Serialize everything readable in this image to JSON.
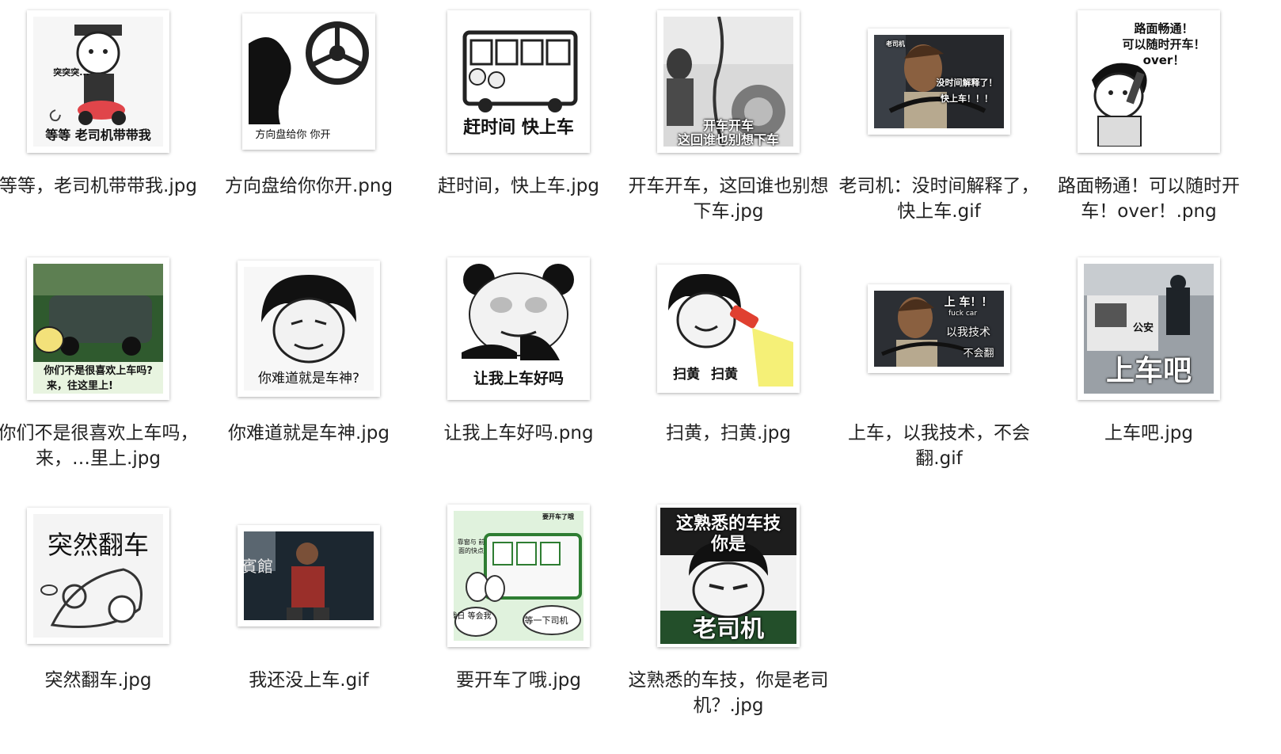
{
  "files": [
    {
      "name": "等等，老司机带带我.jpg",
      "icon": "meme-thumbnail-icon",
      "captions": [
        "突突突...",
        "等等 老司机带带我"
      ]
    },
    {
      "name": "方向盘给你你开.png",
      "icon": "meme-thumbnail-icon",
      "captions": [
        "方向盘给你 你开"
      ]
    },
    {
      "name": "赶时间，快上车.jpg",
      "icon": "meme-thumbnail-icon",
      "captions": [
        "赶时间 快上车"
      ]
    },
    {
      "name": "开车开车，这回谁也别想下车.jpg",
      "icon": "meme-thumbnail-icon",
      "captions": [
        "开车开车",
        "这回谁也别想下车"
      ]
    },
    {
      "name": "老司机：没时间解释了，快上车.gif",
      "icon": "meme-thumbnail-icon",
      "captions": [
        "老司机",
        "没时间解释了！",
        "快上车！！！"
      ]
    },
    {
      "name": "路面畅通！可以随时开车！over！.png",
      "icon": "meme-thumbnail-icon",
      "captions": [
        "路面畅通！",
        "可以随时开车！",
        "over！"
      ]
    },
    {
      "name": "你们不是很喜欢上车吗，来，…里上.jpg",
      "icon": "meme-thumbnail-icon",
      "captions": [
        "你们不是很喜欢上车吗?",
        "来，往这里上!"
      ]
    },
    {
      "name": "你难道就是车神.jpg",
      "icon": "meme-thumbnail-icon",
      "captions": [
        "你难道就是车神?"
      ]
    },
    {
      "name": "让我上车好吗.png",
      "icon": "meme-thumbnail-icon",
      "captions": [
        "让我上车好吗"
      ]
    },
    {
      "name": "扫黄，扫黄.jpg",
      "icon": "meme-thumbnail-icon",
      "captions": [
        "扫黄",
        "扫黄"
      ]
    },
    {
      "name": "上车，以我技术，不会翻.gif",
      "icon": "meme-thumbnail-icon",
      "captions": [
        "上 车！！",
        "fuck car",
        "以我技术",
        "不会翻"
      ]
    },
    {
      "name": "上车吧.jpg",
      "icon": "meme-thumbnail-icon",
      "captions": [
        "公安",
        "上车吧"
      ]
    },
    {
      "name": "突然翻车.jpg",
      "icon": "meme-thumbnail-icon",
      "captions": [
        "突然翻车"
      ]
    },
    {
      "name": "我还没上车.gif",
      "icon": "meme-thumbnail-icon",
      "captions": [
        "賓館"
      ]
    },
    {
      "name": "要开车了哦.jpg",
      "icon": "meme-thumbnail-icon",
      "captions": [
        "要开车了哦",
        "靠窗与 前面的快点",
        "我日 等会我",
        "等一下司机"
      ]
    },
    {
      "name": "这熟悉的车技，你是老司机？.jpg",
      "icon": "meme-thumbnail-icon",
      "captions": [
        "这熟悉的车技",
        "你是",
        "老司机"
      ]
    }
  ],
  "colors": {
    "background": "#ffffff",
    "label_text": "#222222",
    "thumb_border": "#ffffff",
    "thumb_shadow": "rgba(0,0,0,0.32)"
  }
}
